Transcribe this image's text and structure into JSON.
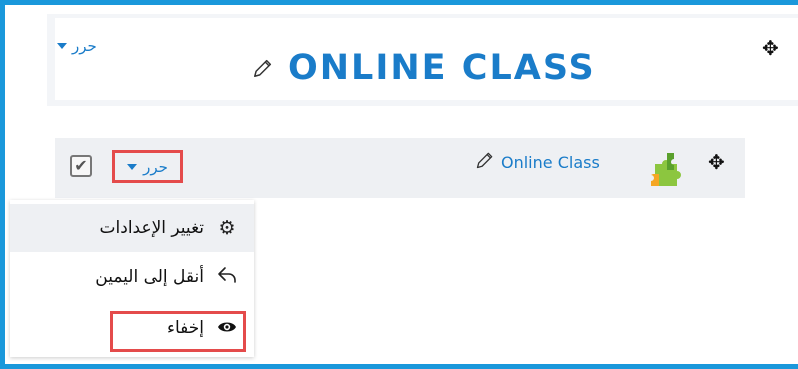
{
  "section": {
    "edit_label": "حرر",
    "title": "ONLINE CLASS"
  },
  "activity": {
    "edit_label": "حرر",
    "name": "Online Class"
  },
  "menu": {
    "items": [
      {
        "label": "تغيير الإعدادات",
        "icon": "gear-icon"
      },
      {
        "label": "أنقل إلى اليمين",
        "icon": "move-right-icon"
      },
      {
        "label": "إخفاء",
        "icon": "eye-icon"
      }
    ]
  },
  "colors": {
    "frame": "#1a98db",
    "link": "#1a7cc9",
    "highlight": "#e44b4b",
    "row_bg": "#eef0f3"
  }
}
